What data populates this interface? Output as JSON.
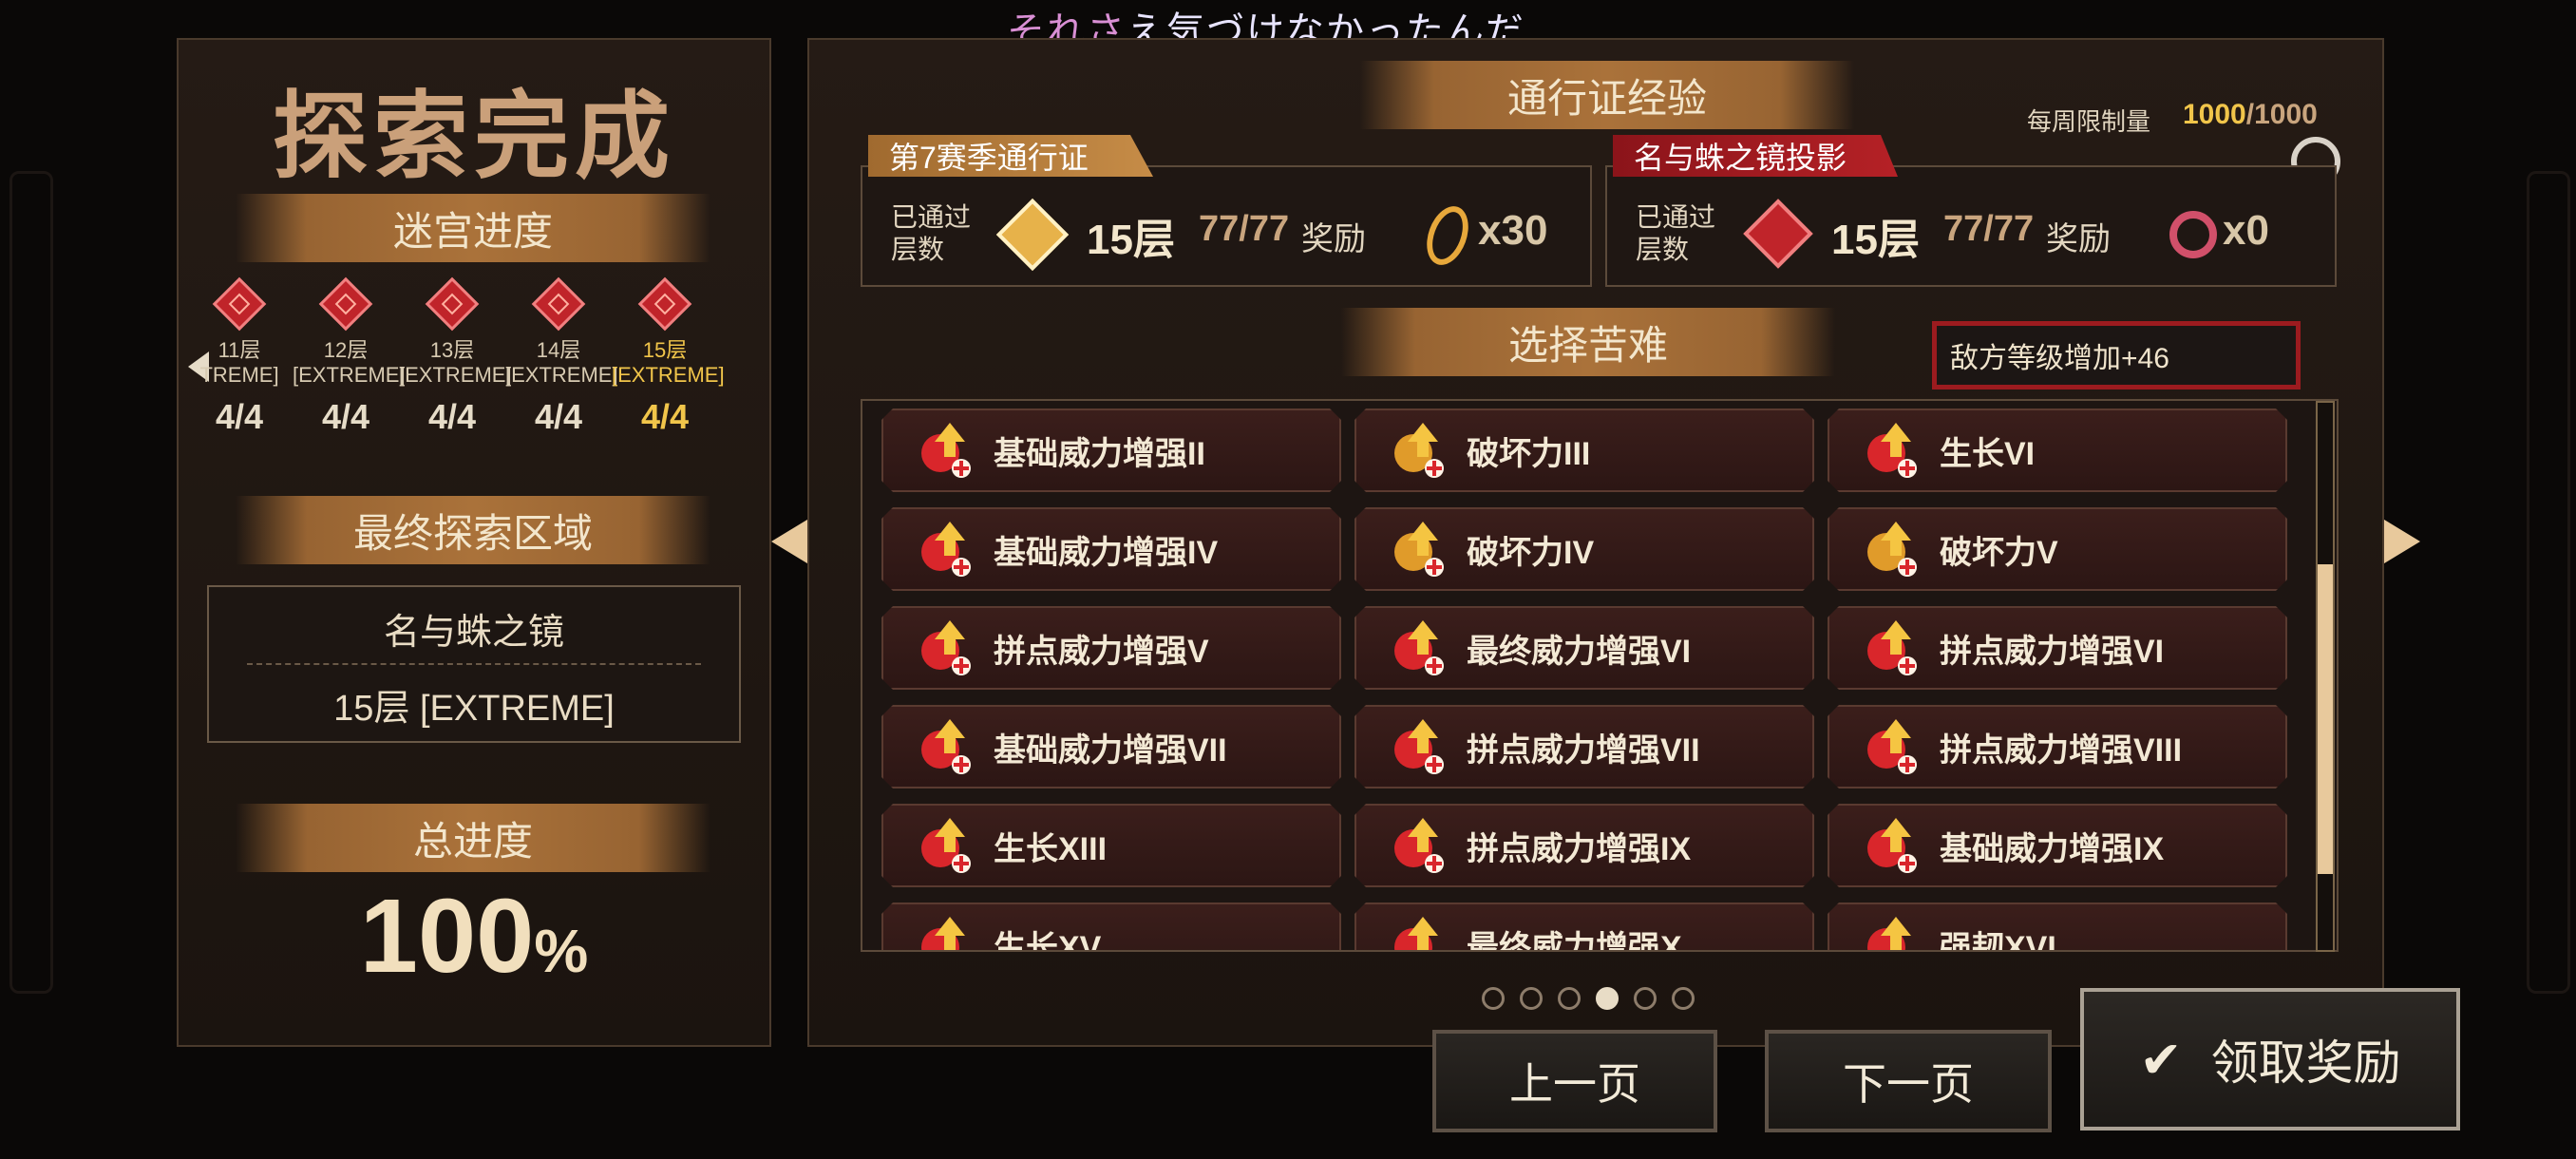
{
  "subtitle": {
    "part1": "それさ",
    "part2": "え気づけなかったんだ"
  },
  "left": {
    "title": "探索完成",
    "labyrinth_progress": "迷宫进度",
    "floors": [
      {
        "label": "11层",
        "difficulty": "TREME]",
        "score": "4/4",
        "active": false
      },
      {
        "label": "12层",
        "difficulty": "[EXTREME]",
        "score": "4/4",
        "active": false
      },
      {
        "label": "13层",
        "difficulty": "[EXTREME]",
        "score": "4/4",
        "active": false
      },
      {
        "label": "14层",
        "difficulty": "[EXTREME]",
        "score": "4/4",
        "active": false
      },
      {
        "label": "15层",
        "difficulty": "[EXTREME]",
        "score": "4/4",
        "active": true
      }
    ],
    "final_area_heading": "最终探索区域",
    "final_area_name": "名与蛛之镜",
    "final_area_floor": "15层 [EXTREME]",
    "total_heading": "总进度",
    "total_value": "100",
    "total_unit": "%"
  },
  "right": {
    "pass_exp_heading": "通行证经验",
    "weekly_limit_label": "每周限制量",
    "weekly_limit_current": "1000",
    "weekly_limit_max": "/1000",
    "season_pass": {
      "tag": "第7赛季通行证",
      "passed_label_1": "已通过",
      "passed_label_2": "层数",
      "floor": "15层",
      "ratio": "77/77",
      "reward_label": "奖励",
      "reward_count": "x30"
    },
    "mirror_pass": {
      "tag": "名与蛛之镜投影",
      "passed_label_1": "已通过",
      "passed_label_2": "层数",
      "floor": "15层",
      "ratio": "77/77",
      "reward_label": "奖励",
      "reward_count": "x0"
    },
    "hardship_heading": "选择苦难",
    "enemy_level": "敌方等级增加+46",
    "cards": [
      [
        "基础威力增强II",
        "破坏力III",
        "生长VI"
      ],
      [
        "基础威力增强IV",
        "破坏力IV",
        "破坏力V"
      ],
      [
        "拼点威力增强V",
        "最终威力增强VI",
        "拼点威力增强VI"
      ],
      [
        "基础威力增强VII",
        "拼点威力增强VII",
        "拼点威力增强VIII"
      ],
      [
        "生长XIII",
        "拼点威力增强IX",
        "基础威力增强IX"
      ],
      [
        "生长XV",
        "最终威力增强X",
        "强韧XVI"
      ]
    ],
    "card_icons": [
      [
        "sword-up-icon",
        "coin-break-icon",
        "heart-up-icon"
      ],
      [
        "sword-up-icon",
        "coin-break-icon",
        "coin-break-icon"
      ],
      [
        "cross-swords-up-icon",
        "fist-up-icon",
        "cross-swords-up-icon"
      ],
      [
        "sword-up-icon",
        "cross-swords-up-icon",
        "cross-swords-up-icon"
      ],
      [
        "heart-up-icon",
        "cross-swords-up-icon",
        "sword-up-icon"
      ],
      [
        "heart-up-icon",
        "fist-up-icon",
        "shield-up-icon"
      ]
    ],
    "page_count": 6,
    "current_page": 4
  },
  "buttons": {
    "prev_page": "上一页",
    "next_page": "下一页",
    "claim": "领取奖励"
  },
  "colors": {
    "accent_gold": "#f1c54a",
    "ribbon_brown": "#aa723a",
    "enemy_border": "#9c1b1f",
    "tag_red": "#b52126"
  }
}
